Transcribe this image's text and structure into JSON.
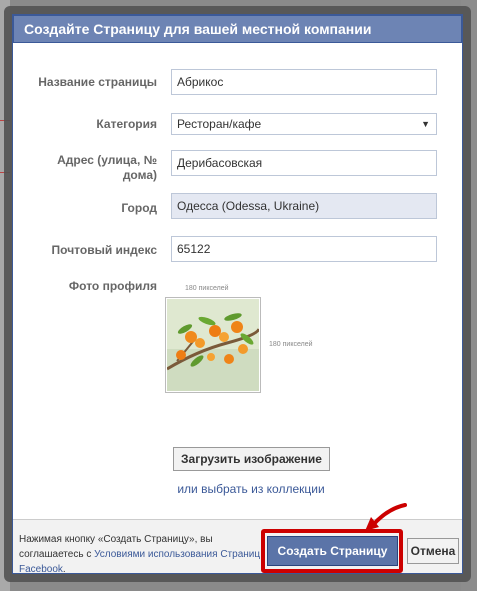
{
  "dialog": {
    "title": "Создайте Страницу для вашей местной компании"
  },
  "form": {
    "page_name_label": "Название страницы",
    "page_name_value": "Абрикос",
    "category_label": "Категория",
    "category_value": "Ресторан/кафе",
    "address_label_line1": "Адрес (улица, №",
    "address_label_line2": "дома)",
    "address_value": "Дерибасовская",
    "city_label": "Город",
    "city_value": "Одесса (Odessa, Ukraine)",
    "zip_label": "Почтовый индекс",
    "zip_value": "65122",
    "photo_label": "Фото профиля",
    "photo_width_hint": "180 пикселей",
    "photo_height_hint": "180 пикселей"
  },
  "actions": {
    "upload_label": "Загрузить изображение",
    "collection_link": "или выбрать из коллекции",
    "footer_text_prefix": "Нажимая кнопку «Создать Страницу», вы соглашаетесь с ",
    "footer_terms_link": "Условиями использования Страниц Facebook",
    "footer_text_suffix": ".",
    "create_label": "Создать Страницу",
    "cancel_label": "Отмена"
  },
  "colors": {
    "header_bg": "#6d84b4",
    "primary_button": "#5b74a8",
    "highlight": "#cc0000",
    "link": "#3b5998"
  }
}
